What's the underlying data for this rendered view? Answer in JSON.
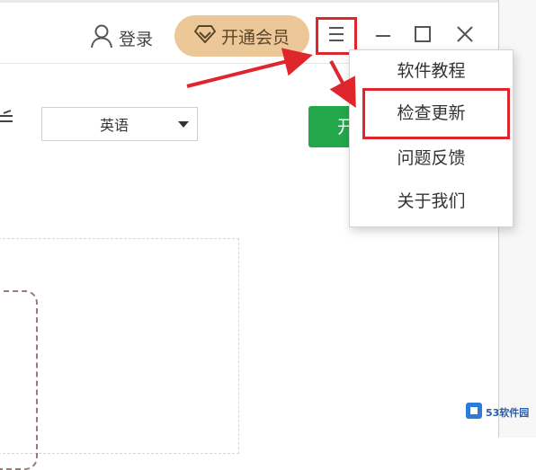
{
  "header": {
    "login_label": "登录",
    "vip_label": "开通会员"
  },
  "toolbar": {
    "language_value": "英语",
    "green_button_label": "开"
  },
  "dropdown_menu": {
    "items": [
      {
        "label": "软件教程"
      },
      {
        "label": "检查更新"
      },
      {
        "label": "问题反馈"
      },
      {
        "label": "关于我们"
      }
    ],
    "highlighted_item": "检查更新"
  },
  "watermark": {
    "text": "53软件园"
  },
  "colors": {
    "annotation_red": "#e0262d",
    "vip_gold": "#ecc898",
    "primary_green": "#22a84a",
    "watermark_blue": "#2d5da8"
  },
  "icons": [
    "user-icon",
    "diamond-icon",
    "menu-icon",
    "minimize-icon",
    "maximize-icon",
    "close-icon",
    "caret-down-icon",
    "arrow-icon"
  ]
}
